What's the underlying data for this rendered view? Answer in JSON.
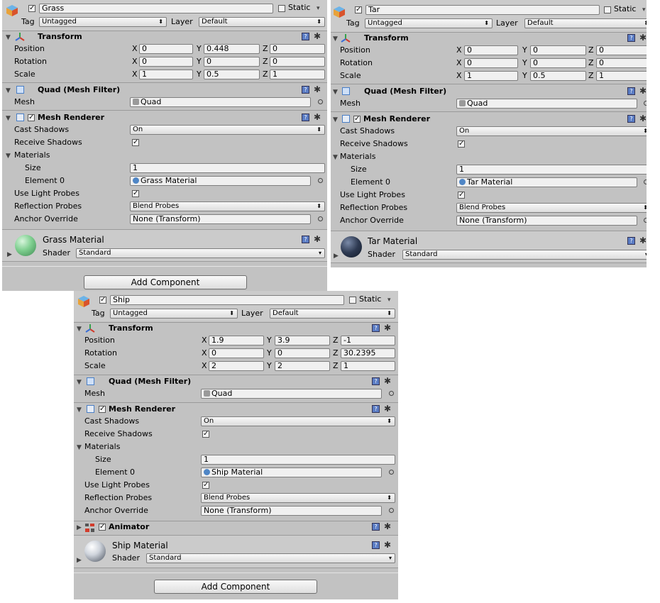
{
  "colors": {
    "panel_bg": "#c2c2c2",
    "header_bg": "#cbcbcb",
    "field_bg": "#f0f0f0",
    "help_icon": "#5a7cc4",
    "mesh_icon": "#4a7fc6",
    "grass_sphere": "#7fcf90",
    "tar_sphere": "#2e3a52",
    "gizmo_red": "#d23c2c",
    "gizmo_green": "#35a14a",
    "gizmo_blue": "#3b6fd6"
  },
  "icons": {
    "gameobject": "cube-icon",
    "transform": "transform-gizmo-icon",
    "mesh_filter": "mesh-filter-icon",
    "mesh_renderer": "mesh-renderer-icon",
    "animator": "animator-icon",
    "help": "help-book-icon",
    "settings": "gear-icon",
    "object_picker": "object-picker-icon"
  },
  "common": {
    "tag_label": "Tag",
    "layer_label": "Layer",
    "static_label": "Static",
    "transform_title": "Transform",
    "position_label": "Position",
    "rotation_label": "Rotation",
    "scale_label": "Scale",
    "ax_x": "X",
    "ax_y": "Y",
    "ax_z": "Z",
    "mesh_filter_title": "Quad (Mesh Filter)",
    "mesh_label": "Mesh",
    "mesh_renderer_title": "Mesh Renderer",
    "cast_shadows_label": "Cast Shadows",
    "receive_shadows_label": "Receive Shadows",
    "materials_label": "Materials",
    "size_label": "Size",
    "element0_label": "Element 0",
    "use_light_probes_label": "Use Light Probes",
    "reflection_probes_label": "Reflection Probes",
    "anchor_override_label": "Anchor Override",
    "shader_label": "Shader",
    "add_component_label": "Add Component",
    "animator_title": "Animator",
    "help_glyph": "?",
    "gear_glyph": "✱",
    "check_glyph": "✓",
    "arrow_glyph": "⬍",
    "fold_open": "▼",
    "fold_closed": "▶",
    "ring_glyph": "◦",
    "dropdown_arrow": "▾"
  },
  "grass": {
    "name": "Grass",
    "tag": "Untagged",
    "layer": "Default",
    "position": {
      "x": "0",
      "y": "0.448",
      "z": "0"
    },
    "rotation": {
      "x": "0",
      "y": "0",
      "z": "0"
    },
    "scale": {
      "x": "1",
      "y": "0.5",
      "z": "1"
    },
    "mesh": "Quad",
    "cast_shadows": "On",
    "size": "1",
    "element0": "Grass Material",
    "reflection_probes": "Blend Probes",
    "anchor_override": "None (Transform)",
    "material_name": "Grass Material",
    "shader": "Standard"
  },
  "tar": {
    "name": "Tar",
    "tag": "Untagged",
    "layer": "Default",
    "position": {
      "x": "0",
      "y": "0",
      "z": "0"
    },
    "rotation": {
      "x": "0",
      "y": "0",
      "z": "0"
    },
    "scale": {
      "x": "1",
      "y": "0.5",
      "z": "1"
    },
    "mesh": "Quad",
    "cast_shadows": "On",
    "size": "1",
    "element0": "Tar Material",
    "reflection_probes": "Blend Probes",
    "anchor_override": "None (Transform)",
    "material_name": "Tar Material",
    "shader": "Standard"
  },
  "ship": {
    "name": "Ship",
    "tag": "Untagged",
    "layer": "Default",
    "position": {
      "x": "1.9",
      "y": "3.9",
      "z": "-1"
    },
    "rotation": {
      "x": "0",
      "y": "0",
      "z": "30.2395"
    },
    "scale": {
      "x": "2",
      "y": "2",
      "z": "1"
    },
    "mesh": "Quad",
    "cast_shadows": "On",
    "size": "1",
    "element0": "Ship Material",
    "reflection_probes": "Blend Probes",
    "anchor_override": "None (Transform)",
    "material_name": "Ship Material",
    "shader": "Standard"
  }
}
